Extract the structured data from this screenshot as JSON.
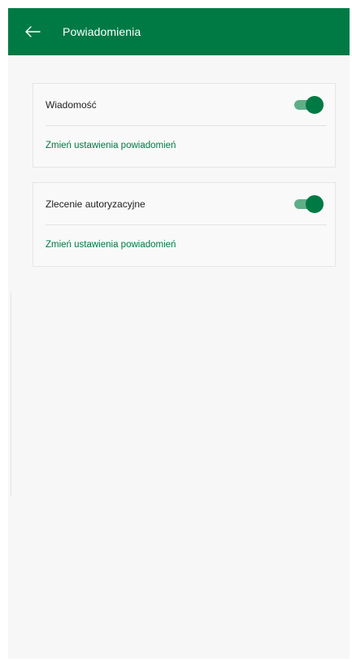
{
  "header": {
    "title": "Powiadomienia",
    "background": "#007a45",
    "back_icon": "arrow-left-icon"
  },
  "cards": [
    {
      "label": "Wiadomość",
      "toggle_on": true,
      "link": "Zmień ustawienia powiadomień"
    },
    {
      "label": "Zlecenie autoryzacyjne",
      "toggle_on": true,
      "link": "Zmień ustawienia powiadomień"
    }
  ],
  "colors": {
    "accent": "#007a45",
    "toggle_track": "#5fae88",
    "background": "#f7f7f7"
  }
}
